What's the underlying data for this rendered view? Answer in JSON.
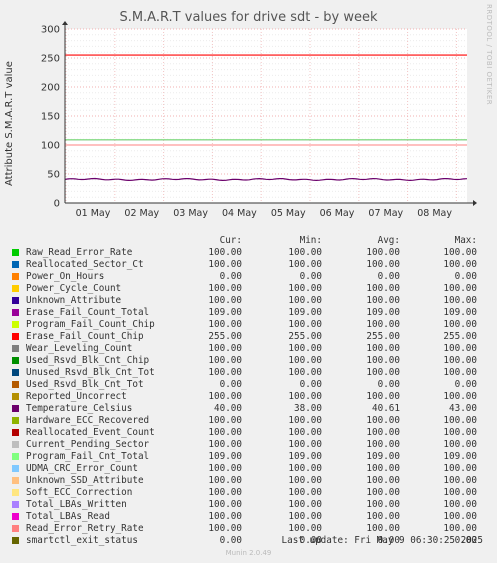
{
  "chart_data": {
    "type": "line",
    "title": "S.M.A.R.T values for drive sdt - by week",
    "ylabel": "Attribute S.M.A.R.T value",
    "ylim": [
      0,
      300
    ],
    "yticks": [
      0,
      50,
      100,
      150,
      200,
      250,
      300
    ],
    "xticks": [
      "01 May",
      "02 May",
      "03 May",
      "04 May",
      "05 May",
      "06 May",
      "07 May",
      "08 May"
    ],
    "legend_placement": "bottom",
    "columns": [
      "Cur:",
      "Min:",
      "Avg:",
      "Max:"
    ],
    "series": [
      {
        "name": "Raw_Read_Error_Rate",
        "color": "#00cc00",
        "cur": "100.00",
        "min": "100.00",
        "avg": "100.00",
        "max": "100.00"
      },
      {
        "name": "Reallocated_Sector_Ct",
        "color": "#0066b3",
        "cur": "100.00",
        "min": "100.00",
        "avg": "100.00",
        "max": "100.00"
      },
      {
        "name": "Power_On_Hours",
        "color": "#ff8000",
        "cur": "0.00",
        "min": "0.00",
        "avg": "0.00",
        "max": "0.00"
      },
      {
        "name": "Power_Cycle_Count",
        "color": "#ffcc00",
        "cur": "100.00",
        "min": "100.00",
        "avg": "100.00",
        "max": "100.00"
      },
      {
        "name": "Unknown_Attribute",
        "color": "#330099",
        "cur": "100.00",
        "min": "100.00",
        "avg": "100.00",
        "max": "100.00"
      },
      {
        "name": "Erase_Fail_Count_Total",
        "color": "#990099",
        "cur": "109.00",
        "min": "109.00",
        "avg": "109.00",
        "max": "109.00"
      },
      {
        "name": "Program_Fail_Count_Chip",
        "color": "#ccff00",
        "cur": "100.00",
        "min": "100.00",
        "avg": "100.00",
        "max": "100.00"
      },
      {
        "name": "Erase_Fail_Count_Chip",
        "color": "#ff0000",
        "cur": "255.00",
        "min": "255.00",
        "avg": "255.00",
        "max": "255.00"
      },
      {
        "name": "Wear_Leveling_Count",
        "color": "#808080",
        "cur": "100.00",
        "min": "100.00",
        "avg": "100.00",
        "max": "100.00"
      },
      {
        "name": "Used_Rsvd_Blk_Cnt_Chip",
        "color": "#008f00",
        "cur": "100.00",
        "min": "100.00",
        "avg": "100.00",
        "max": "100.00"
      },
      {
        "name": "Unused_Rsvd_Blk_Cnt_Tot",
        "color": "#00487d",
        "cur": "100.00",
        "min": "100.00",
        "avg": "100.00",
        "max": "100.00"
      },
      {
        "name": "Used_Rsvd_Blk_Cnt_Tot",
        "color": "#b35a00",
        "cur": "0.00",
        "min": "0.00",
        "avg": "0.00",
        "max": "0.00"
      },
      {
        "name": "Reported_Uncorrect",
        "color": "#b38f00",
        "cur": "100.00",
        "min": "100.00",
        "avg": "100.00",
        "max": "100.00"
      },
      {
        "name": "Temperature_Celsius",
        "color": "#6b006b",
        "cur": "40.00",
        "min": "38.00",
        "avg": "40.61",
        "max": "43.00"
      },
      {
        "name": "Hardware_ECC_Recovered",
        "color": "#8fb300",
        "cur": "100.00",
        "min": "100.00",
        "avg": "100.00",
        "max": "100.00"
      },
      {
        "name": "Reallocated_Event_Count",
        "color": "#b30000",
        "cur": "100.00",
        "min": "100.00",
        "avg": "100.00",
        "max": "100.00"
      },
      {
        "name": "Current_Pending_Sector",
        "color": "#bebebe",
        "cur": "100.00",
        "min": "100.00",
        "avg": "100.00",
        "max": "100.00"
      },
      {
        "name": "Program_Fail_Cnt_Total",
        "color": "#80ff80",
        "cur": "109.00",
        "min": "109.00",
        "avg": "109.00",
        "max": "109.00"
      },
      {
        "name": "UDMA_CRC_Error_Count",
        "color": "#80c9ff",
        "cur": "100.00",
        "min": "100.00",
        "avg": "100.00",
        "max": "100.00"
      },
      {
        "name": "Unknown_SSD_Attribute",
        "color": "#ffc080",
        "cur": "100.00",
        "min": "100.00",
        "avg": "100.00",
        "max": "100.00"
      },
      {
        "name": "Soft_ECC_Correction",
        "color": "#ffe680",
        "cur": "100.00",
        "min": "100.00",
        "avg": "100.00",
        "max": "100.00"
      },
      {
        "name": "Total_LBAs_Written",
        "color": "#aa80ff",
        "cur": "100.00",
        "min": "100.00",
        "avg": "100.00",
        "max": "100.00"
      },
      {
        "name": "Total_LBAs_Read",
        "color": "#ee00cc",
        "cur": "100.00",
        "min": "100.00",
        "avg": "100.00",
        "max": "100.00"
      },
      {
        "name": "Read_Error_Retry_Rate",
        "color": "#ff8080",
        "cur": "100.00",
        "min": "100.00",
        "avg": "100.00",
        "max": "100.00"
      },
      {
        "name": "smartctl_exit_status",
        "color": "#666600",
        "cur": "0.00",
        "min": "0.00",
        "avg": "0.00",
        "max": "0.00"
      }
    ]
  },
  "side_text": "RRDTOOL / TOBI OETIKER",
  "last_update": "Last update: Fri May  9 06:30:25 2025",
  "munin_version": "Munin 2.0.49"
}
